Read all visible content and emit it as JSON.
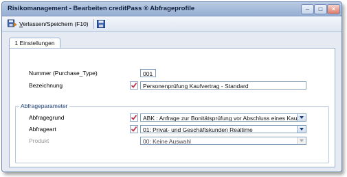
{
  "window": {
    "title": "Risikomanagement - Bearbeiten creditPass ®  Abfrageprofile",
    "controls": [
      "minimize-icon",
      "maximize-icon",
      "close-icon"
    ]
  },
  "toolbar": {
    "save_exit_label": "Verlassen/Speichern (F10)",
    "save_exit_icon": "save-exit-icon",
    "save_icon": "floppy-disk-icon"
  },
  "tabs": [
    {
      "label": "1 Einstellungen",
      "active": true
    }
  ],
  "settings": {
    "nummer_label": "Nummer (Purchase_Type)",
    "nummer_value": "001",
    "bezeichnung_label": "Bezeichnung",
    "bezeichnung_value": "Personenprüfung Kaufvertrag - Standard"
  },
  "abfrageparameter": {
    "group_title": "Abfrageparameter",
    "abfragegrund_label": "Abfragegrund",
    "abfragegrund_value": "ABK : Anfrage zur Bonitätsprüfung vor Abschluss eines Kaufve",
    "abfrageart_label": "Abfrageart",
    "abfrageart_value": "01: Privat- und Geschäftskunden Realtime",
    "produkt_label": "Produkt",
    "produkt_value": "00: Keine Auswahl"
  },
  "colors": {
    "titlebar": "#a7bcdb",
    "window_bg": "#e6ebf3",
    "group_title": "#1a3d7a",
    "check_red": "#c0304a"
  }
}
